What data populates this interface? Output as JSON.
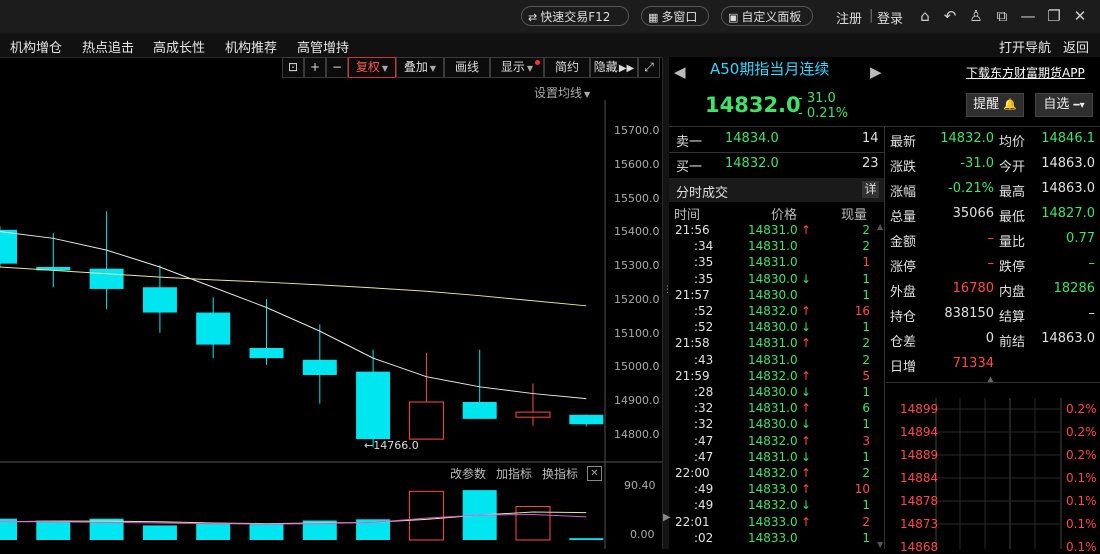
{
  "titlebar": {
    "quick_trade": "快速交易F12",
    "multi_window": "多窗口",
    "custom_panel": "自定义面板",
    "register": "注册",
    "divider": "|",
    "login": "登录"
  },
  "menubar": {
    "items": [
      "机构增仓",
      "热点追击",
      "高成长性",
      "机构推荐",
      "高管增持"
    ],
    "open_nav": "打开导航",
    "back": "返回"
  },
  "toolbar": {
    "plus": "+",
    "minus": "−",
    "restore": "复权",
    "overlay": "叠加",
    "draw": "画线",
    "display": "显示",
    "simple": "简约",
    "hide": "隐藏"
  },
  "chart": {
    "ma_setting": "设置均线",
    "y_labels": [
      "15700.0",
      "15600.0",
      "15500.0",
      "15400.0",
      "15300.0",
      "15200.0",
      "15100.0",
      "15000.0",
      "14900.0",
      "14800.0"
    ],
    "low_marker": "←14766.0",
    "indicator_buttons": [
      "改参数",
      "加指标",
      "换指标"
    ],
    "vol_labels": [
      "90.40",
      "0.00"
    ]
  },
  "chart_data": {
    "type": "candlestick",
    "ylim": [
      14700,
      15780
    ],
    "candles": [
      {
        "o": 15410,
        "c": 15310,
        "h": 15420,
        "l": 15300
      },
      {
        "o": 15300,
        "c": 15290,
        "h": 15400,
        "l": 15240
      },
      {
        "o": 15295,
        "c": 15235,
        "h": 15465,
        "l": 15175
      },
      {
        "o": 15240,
        "c": 15165,
        "h": 15305,
        "l": 15105
      },
      {
        "o": 15165,
        "c": 15070,
        "h": 15210,
        "l": 15030
      },
      {
        "o": 15060,
        "c": 15030,
        "h": 15205,
        "l": 15010
      },
      {
        "o": 15025,
        "c": 14980,
        "h": 15130,
        "l": 14895
      },
      {
        "o": 14990,
        "c": 14790,
        "h": 15055,
        "l": 14766
      },
      {
        "o": 14790,
        "c": 14900,
        "h": 15045,
        "l": 14790
      },
      {
        "o": 14900,
        "c": 14850,
        "h": 15055,
        "l": 14850
      },
      {
        "o": 14855,
        "c": 14870,
        "h": 14955,
        "l": 14830
      },
      {
        "o": 14862,
        "c": 14834,
        "h": 14862,
        "l": 14828
      }
    ],
    "ma_white": [
      15405,
      15385,
      15350,
      15300,
      15240,
      15180,
      15110,
      15030,
      14975,
      14945,
      14925,
      14910
    ],
    "ma_yellow": [
      15300,
      15290,
      15280,
      15270,
      15262,
      15255,
      15247,
      15238,
      15228,
      15215,
      15200,
      15185
    ],
    "volume": [
      35,
      32,
      35,
      24,
      28,
      26,
      32,
      34,
      80,
      82,
      55,
      3
    ],
    "volume_max": 90.4
  },
  "quote": {
    "name": "A50期指当月连续",
    "download": "下载东方财富期货APP",
    "price": "14832.0",
    "change": "- 31.0",
    "change_pct": "- 0.21%",
    "remind": "提醒",
    "watchlist": "自选"
  },
  "orderbook": {
    "ask_label": "卖一",
    "ask_price": "14834.0",
    "ask_qty": "14",
    "bid_label": "买一",
    "bid_price": "14832.0",
    "bid_qty": "23"
  },
  "ticks_header": {
    "title": "分时成交",
    "detail": "详",
    "col_time": "时间",
    "col_price": "价格",
    "col_qty": "现量"
  },
  "ticks": [
    {
      "time": "21:56",
      "price": "14831.0",
      "dir": "up",
      "qty": "2",
      "qc": "green"
    },
    {
      "time": ":34",
      "price": "14831.0",
      "dir": "",
      "qty": "2",
      "qc": "green"
    },
    {
      "time": ":35",
      "price": "14831.0",
      "dir": "",
      "qty": "1",
      "qc": "red"
    },
    {
      "time": ":35",
      "price": "14830.0",
      "dir": "down",
      "qty": "1",
      "qc": "green"
    },
    {
      "time": "21:57",
      "price": "14830.0",
      "dir": "",
      "qty": "1",
      "qc": "green"
    },
    {
      "time": ":52",
      "price": "14832.0",
      "dir": "up",
      "qty": "16",
      "qc": "red"
    },
    {
      "time": ":52",
      "price": "14830.0",
      "dir": "down",
      "qty": "1",
      "qc": "green"
    },
    {
      "time": "21:58",
      "price": "14831.0",
      "dir": "up",
      "qty": "2",
      "qc": "green"
    },
    {
      "time": ":43",
      "price": "14831.0",
      "dir": "",
      "qty": "2",
      "qc": "green"
    },
    {
      "time": "21:59",
      "price": "14832.0",
      "dir": "up",
      "qty": "5",
      "qc": "red"
    },
    {
      "time": ":28",
      "price": "14830.0",
      "dir": "down",
      "qty": "1",
      "qc": "green"
    },
    {
      "time": ":32",
      "price": "14831.0",
      "dir": "up",
      "qty": "6",
      "qc": "green"
    },
    {
      "time": ":32",
      "price": "14830.0",
      "dir": "down",
      "qty": "1",
      "qc": "green"
    },
    {
      "time": ":47",
      "price": "14832.0",
      "dir": "up",
      "qty": "3",
      "qc": "red"
    },
    {
      "time": ":47",
      "price": "14831.0",
      "dir": "down",
      "qty": "1",
      "qc": "green"
    },
    {
      "time": "22:00",
      "price": "14832.0",
      "dir": "up",
      "qty": "2",
      "qc": "green"
    },
    {
      "time": ":49",
      "price": "14833.0",
      "dir": "up",
      "qty": "10",
      "qc": "red"
    },
    {
      "time": ":49",
      "price": "14832.0",
      "dir": "down",
      "qty": "1",
      "qc": "green"
    },
    {
      "time": "22:01",
      "price": "14833.0",
      "dir": "up",
      "qty": "2",
      "qc": "red"
    },
    {
      "time": ":02",
      "price": "14833.0",
      "dir": "",
      "qty": "1",
      "qc": "green"
    }
  ],
  "stats": [
    {
      "l1": "最新",
      "v1": "14832.0",
      "c1": "green",
      "l2": "均价",
      "v2": "14846.1",
      "c2": "green"
    },
    {
      "l1": "涨跌",
      "v1": "-31.0",
      "c1": "green",
      "l2": "今开",
      "v2": "14863.0",
      "c2": "white"
    },
    {
      "l1": "涨幅",
      "v1": "-0.21%",
      "c1": "green",
      "l2": "最高",
      "v2": "14863.0",
      "c2": "white"
    },
    {
      "l1": "总量",
      "v1": "35066",
      "c1": "white",
      "l2": "最低",
      "v2": "14827.0",
      "c2": "green"
    },
    {
      "l1": "金额",
      "v1": "–",
      "c1": "red",
      "l2": "量比",
      "v2": "0.77",
      "c2": "green"
    },
    {
      "l1": "涨停",
      "v1": "–",
      "c1": "red",
      "l2": "跌停",
      "v2": "–",
      "c2": "green"
    },
    {
      "l1": "外盘",
      "v1": "16780",
      "c1": "red",
      "l2": "内盘",
      "v2": "18286",
      "c2": "green"
    },
    {
      "l1": "持仓",
      "v1": "838150",
      "c1": "white",
      "l2": "结算",
      "v2": "–",
      "c2": "white"
    },
    {
      "l1": "仓差",
      "v1": "0",
      "c1": "white",
      "l2": "前结",
      "v2": "14863.0",
      "c2": "white"
    },
    {
      "l1": "日增",
      "v1": "71334",
      "c1": "red",
      "l2": "",
      "v2": "",
      "c2": "white"
    }
  ],
  "mini_chart": {
    "left_labels": [
      "14899",
      "14894",
      "14889",
      "14884",
      "14878",
      "14873",
      "14868"
    ],
    "right_labels": [
      "0.2%",
      "0.2%",
      "0.2%",
      "0.1%",
      "0.1%",
      "0.1%",
      "0.1%"
    ]
  }
}
